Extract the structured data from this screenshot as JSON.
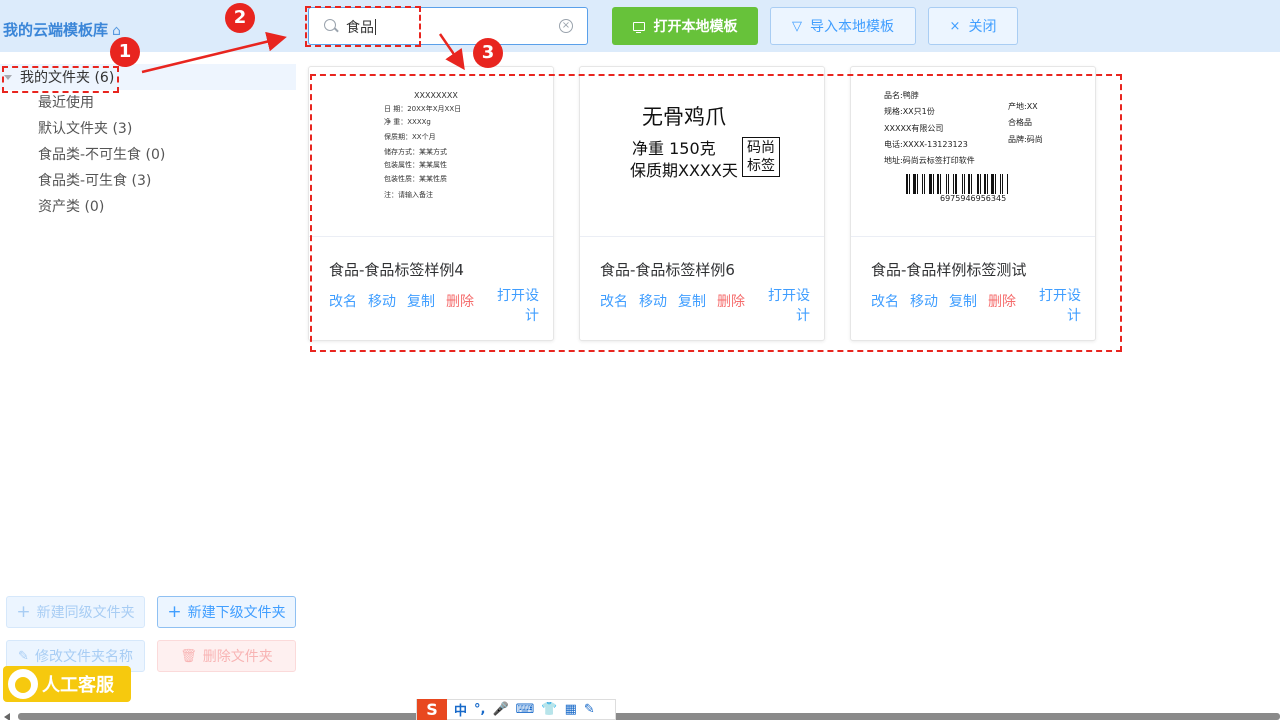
{
  "header": {
    "library_title": "我的云端模板库",
    "home_icon": "home-icon",
    "search": {
      "value": "食品",
      "placeholder": ""
    },
    "buttons": {
      "open_local": "打开本地模板",
      "import_local": "导入本地模板",
      "close": "关闭"
    }
  },
  "sidebar": {
    "root": "我的文件夹 (6)",
    "items": [
      {
        "label": "最近使用"
      },
      {
        "label": "默认文件夹 (3)"
      },
      {
        "label": "食品类-不可生食 (0)"
      },
      {
        "label": "食品类-可生食 (3)"
      },
      {
        "label": "资产类 (0)"
      }
    ],
    "buttons": {
      "new_sibling": "新建同级文件夹",
      "new_child": "新建下级文件夹",
      "rename": "修改文件夹名称",
      "delete": "删除文件夹"
    },
    "support": "人工客服"
  },
  "actions": {
    "rename": "改名",
    "move": "移动",
    "copy": "复制",
    "delete": "删除",
    "open_design": "打开设计"
  },
  "cards": [
    {
      "title": "食品-食品标签样例4",
      "preview": {
        "name": "XXXXXXXX",
        "date": "日  期：20XX年X月XX日",
        "weight": "净  重：XXXXg",
        "shelf": "保质期：XX个月",
        "storage": "储存方式：某某方式",
        "package": "包装属性：某某属性",
        "material": "包装性质：某某性质",
        "note": "注：请输入备注"
      }
    },
    {
      "title": "食品-食品标签样例6",
      "preview": {
        "title": "无骨鸡爪",
        "weight": "净重 150克",
        "shelf": "保质期XXXX天",
        "box_line1": "码尚",
        "box_line2": "标签"
      }
    },
    {
      "title": "食品-食品样例标签测试",
      "preview": {
        "name": "品名:鸭脖",
        "spec": "规格:XX只1份",
        "company": "XXXXX有限公司",
        "phone": "电话:XXXX-13123123",
        "address": "地址:码尚云标签打印软件",
        "origin": "产地:XX",
        "quality": "合格品",
        "brand": "品牌:码尚",
        "barcode": "6975946956345"
      }
    }
  ],
  "annotations": {
    "one": "1",
    "two": "2",
    "three": "3"
  },
  "ime": {
    "mode": "中",
    "punct": "°,",
    "logo": "S"
  }
}
